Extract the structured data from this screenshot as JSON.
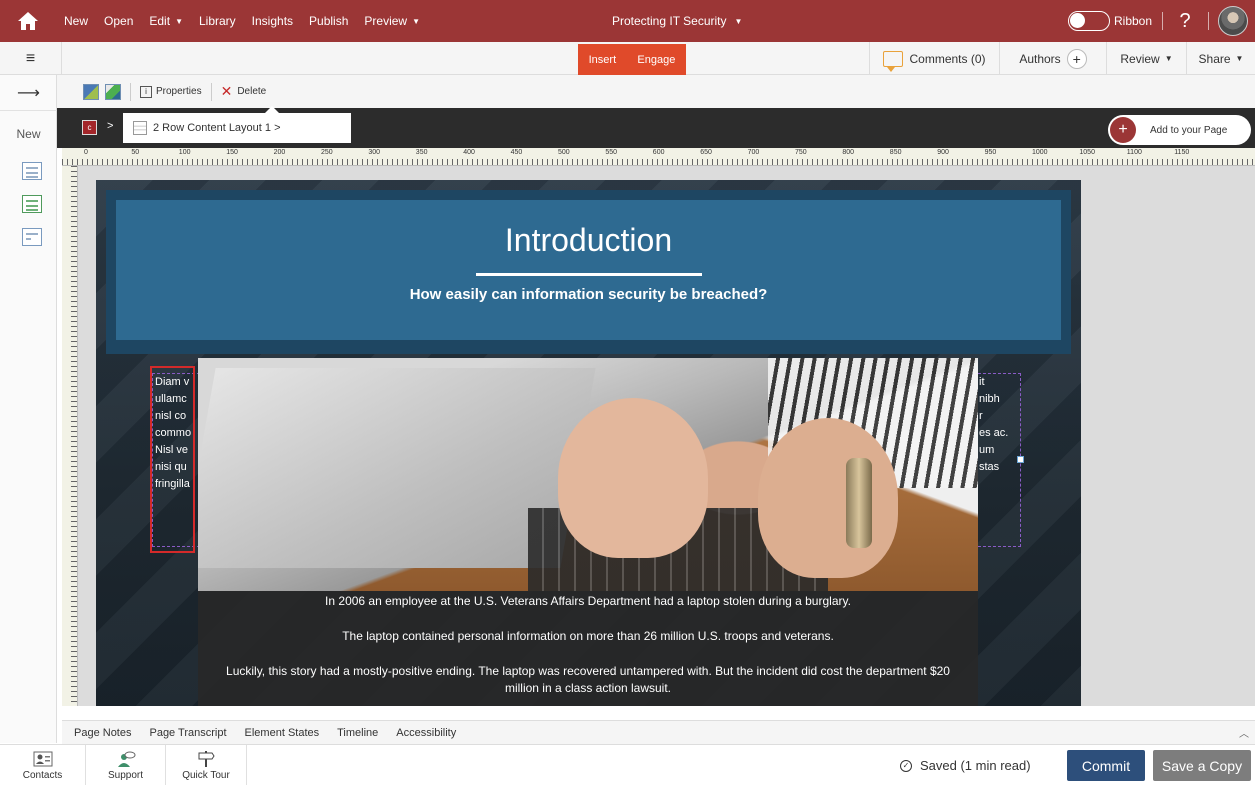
{
  "topbar": {
    "nav": [
      {
        "label": "New",
        "caret": false
      },
      {
        "label": "Open",
        "caret": false
      },
      {
        "label": "Edit",
        "caret": true
      },
      {
        "label": "Library",
        "caret": false
      },
      {
        "label": "Insights",
        "caret": false
      },
      {
        "label": "Publish",
        "caret": false
      },
      {
        "label": "Preview",
        "caret": true
      }
    ],
    "course_title": "Protecting IT Security",
    "ribbon_label": "Ribbon",
    "help_label": "?"
  },
  "secondbar": {
    "insert_label": "Insert",
    "engage_label": "Engage",
    "comments_label": "Comments (0)",
    "authors_label": "Authors",
    "review_label": "Review",
    "share_label": "Share"
  },
  "leftrail": {
    "new_label": "New"
  },
  "element_toolbar": {
    "properties_label": "Properties",
    "delete_label": "Delete"
  },
  "breadcrumb": {
    "separator": ">",
    "item_label": "2 Row Content Layout 1 >",
    "add_page_label": "Add to your Page"
  },
  "ruler": {
    "labels": [
      "0",
      "50",
      "100",
      "150",
      "200",
      "250",
      "300",
      "350",
      "400",
      "450",
      "500",
      "550",
      "600",
      "650",
      "700",
      "750",
      "800",
      "850",
      "900",
      "950",
      "1000",
      "1050",
      "1100",
      "1150"
    ]
  },
  "slide": {
    "title": "Introduction",
    "subtitle": "How easily can information security be breached?",
    "text_left": [
      "Diam v",
      "ullamc",
      "nisl co",
      "commo",
      "Nisl ve",
      "nisi qu",
      "fringilla"
    ],
    "text_right": [
      "it",
      "nibh",
      "r",
      "es ac.",
      "um",
      "stas",
      ""
    ],
    "caption": [
      "In 2006 an employee at the U.S. Veterans Affairs Department had a laptop stolen during a burglary.",
      "The laptop contained personal information on more than 26 million U.S. troops and veterans.",
      "Luckily, this story had a mostly-positive ending. The laptop was recovered untampered with. But the incident did cost the department $20 million in a class action lawsuit."
    ]
  },
  "bottom_tabs": [
    "Page Notes",
    "Page Transcript",
    "Element States",
    "Timeline",
    "Accessibility"
  ],
  "footer": {
    "contacts_label": "Contacts",
    "support_label": "Support",
    "tour_label": "Quick Tour",
    "saved_label": "Saved (1 min read)",
    "commit_label": "Commit",
    "save_copy_label": "Save a Copy"
  },
  "colors": {
    "brand": "#9b3636",
    "insert_engage": "#e04a2a",
    "banner": "#2e6a91",
    "commit": "#2d4f7b"
  }
}
